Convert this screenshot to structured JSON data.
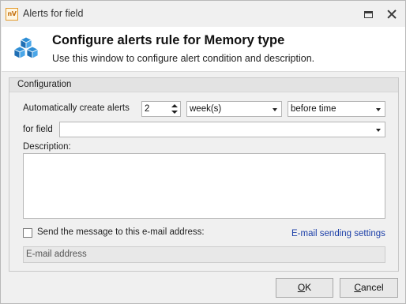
{
  "window": {
    "app_icon_text": "nV",
    "title": "Alerts for field"
  },
  "header": {
    "title": "Configure alerts rule for Memory type",
    "subtitle": "Use this window to configure alert condition and description.",
    "icon": "cubes-icon",
    "icon_color": "#2f8fd6"
  },
  "configuration": {
    "group_title": "Configuration",
    "auto_create_label": "Automatically create alerts",
    "count_value": "2",
    "unit_value": "week(s)",
    "timing_value": "before time",
    "for_field_label": "for field",
    "for_field_value": "",
    "description_label": "Description:",
    "description_value": "",
    "send_email_label": "Send the message to this e-mail address:",
    "send_email_checked": false,
    "email_settings_link": "E-mail sending settings",
    "email_placeholder": "E-mail address"
  },
  "buttons": {
    "ok": "OK",
    "cancel": "Cancel"
  }
}
